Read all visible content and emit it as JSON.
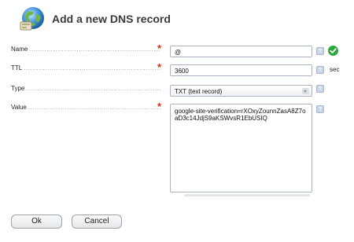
{
  "dialog": {
    "title": "Add a new DNS record",
    "icon": "globe-icon"
  },
  "form": {
    "name": {
      "label": "Name",
      "value": "@",
      "required": true,
      "status": "valid"
    },
    "ttl": {
      "label": "TTL",
      "value": "3600",
      "required": true,
      "unit": "sec"
    },
    "type": {
      "label": "Type",
      "selected": "TXT (text record)",
      "required": false
    },
    "value": {
      "label": "Value",
      "value": "google-site-verification=rXOxyZounnZasA8Z7oaD3c14JdjS9aKSWvsR1EbUSIQ",
      "required": true
    },
    "required_marker": "*",
    "help_marker": "?"
  },
  "buttons": {
    "ok": "Ok",
    "cancel": "Cancel"
  },
  "colors": {
    "required": "#e0261c",
    "valid": "#2aa83a",
    "help": "#c9d5e6"
  }
}
